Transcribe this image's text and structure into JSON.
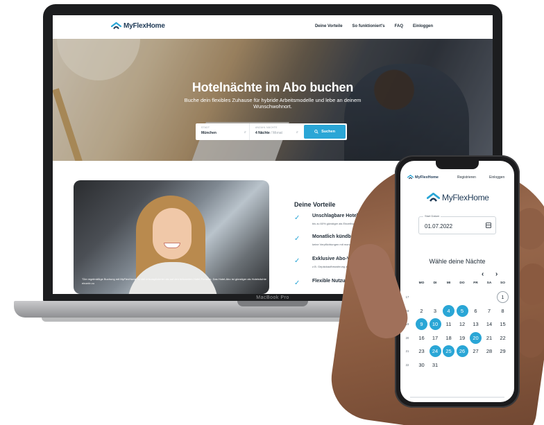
{
  "laptop": {
    "brand": "MacBook Pro"
  },
  "site": {
    "logo": "MyFlexHome",
    "nav": [
      "Deine Vorteile",
      "So funktioniert's",
      "FAQ",
      "Einloggen"
    ],
    "hero": {
      "title": "Hotelnächte im Abo buchen",
      "subtitle": "Buche dein flexibles Zuhause für hybride Arbeitsmodelle und lebe an deinem Wunschwohnort."
    },
    "search": {
      "city_label": "STADT",
      "city_value": "München",
      "nights_label": "ANZAHL NÄCHTE",
      "nights_value": "4 Nächte",
      "nights_unit": "/ Monat",
      "button": "Suchen"
    },
    "photo_caption": "\"Die regelmäßige Buchung mit MyFlexHome ist viel unkomplizierter als auf den bekannten Hotel-Portalen. Das Hotel-Abo ist günstiger als Hotelnächte einzeln zu",
    "vorteile": {
      "title": "Deine Vorteile",
      "items": [
        {
          "title": "Unschlagbare Hoteltarife",
          "desc": "bis zu 60% günstiger als Einzelbuchungen"
        },
        {
          "title": "Monatlich kündbar",
          "desc": "keine Verpflichtungen mit monatlicher"
        },
        {
          "title": "Exklusive Abo-Vorteile",
          "desc": "z.B. Gepäckaufbewahrung zwischen"
        },
        {
          "title": "Flexible Nutzung",
          "desc": ""
        }
      ]
    }
  },
  "phone": {
    "nav_logo": "MyFlexHome",
    "register": "Registrieren",
    "login": "Einloggen",
    "logo": "MyFlexHome",
    "date_label": "Start Datum",
    "date_value": "01.07.2022",
    "heading": "Wähle deine Nächte",
    "prev": "‹",
    "next": "›",
    "weekdays": [
      "MO",
      "DI",
      "MI",
      "DO",
      "FR",
      "SA",
      "SO"
    ],
    "weeks": [
      {
        "week": "17",
        "days": [
          "",
          "",
          "",
          "",
          "",
          "",
          "1"
        ]
      },
      {
        "week": "18",
        "days": [
          "2",
          "3",
          "4",
          "5",
          "6",
          "7",
          "8"
        ]
      },
      {
        "week": "19",
        "days": [
          "9",
          "10",
          "11",
          "12",
          "13",
          "14",
          "15"
        ]
      },
      {
        "week": "20",
        "days": [
          "16",
          "17",
          "18",
          "19",
          "20",
          "21",
          "22"
        ]
      },
      {
        "week": "21",
        "days": [
          "23",
          "24",
          "25",
          "26",
          "27",
          "28",
          "29"
        ]
      },
      {
        "week": "22",
        "days": [
          "30",
          "31",
          "",
          "",
          "",
          "",
          ""
        ]
      }
    ],
    "selected_days": [
      "4",
      "5",
      "9",
      "10",
      "20",
      "24",
      "25",
      "26"
    ],
    "today": "1",
    "accent": "#2aa6d6"
  }
}
